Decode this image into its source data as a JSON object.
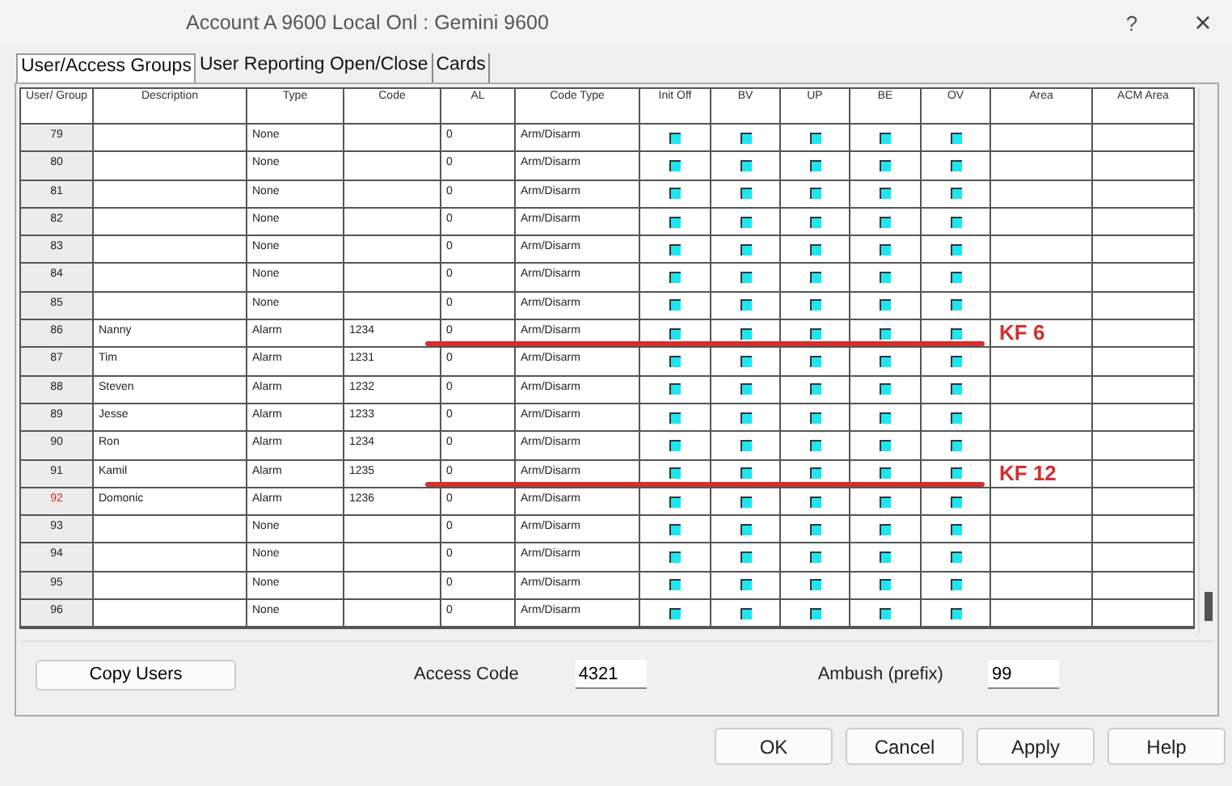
{
  "window": {
    "title": "Account A 9600 Local Onl : Gemini 9600",
    "help": "?",
    "close": "×"
  },
  "tabs": [
    {
      "label": "User/Access Groups",
      "selected": true
    },
    {
      "label": "User Reporting Open/Close",
      "selected": false
    },
    {
      "label": "Cards",
      "selected": false
    }
  ],
  "table": {
    "columns": [
      "User/ Group",
      "Description",
      "Type",
      "Code",
      "AL",
      "Code Type",
      "Init Off",
      "BV",
      "UP",
      "BE",
      "OV",
      "Area",
      "ACM Area"
    ],
    "rows": [
      {
        "user": "79",
        "description": "",
        "type": "None",
        "code": "",
        "al": "0",
        "code_type": "Arm/Disarm",
        "flags": [
          true,
          true,
          true,
          true,
          true
        ],
        "highlighted": false
      },
      {
        "user": "80",
        "description": "",
        "type": "None",
        "code": "",
        "al": "0",
        "code_type": "Arm/Disarm",
        "flags": [
          true,
          true,
          true,
          true,
          true
        ],
        "highlighted": false
      },
      {
        "user": "81",
        "description": "",
        "type": "None",
        "code": "",
        "al": "0",
        "code_type": "Arm/Disarm",
        "flags": [
          true,
          true,
          true,
          true,
          true
        ],
        "highlighted": false
      },
      {
        "user": "82",
        "description": "",
        "type": "None",
        "code": "",
        "al": "0",
        "code_type": "Arm/Disarm",
        "flags": [
          true,
          true,
          true,
          true,
          true
        ],
        "highlighted": false
      },
      {
        "user": "83",
        "description": "",
        "type": "None",
        "code": "",
        "al": "0",
        "code_type": "Arm/Disarm",
        "flags": [
          true,
          true,
          true,
          true,
          true
        ],
        "highlighted": false
      },
      {
        "user": "84",
        "description": "",
        "type": "None",
        "code": "",
        "al": "0",
        "code_type": "Arm/Disarm",
        "flags": [
          true,
          true,
          true,
          true,
          true
        ],
        "highlighted": false
      },
      {
        "user": "85",
        "description": "",
        "type": "None",
        "code": "",
        "al": "0",
        "code_type": "Arm/Disarm",
        "flags": [
          true,
          true,
          true,
          true,
          true
        ],
        "highlighted": false
      },
      {
        "user": "86",
        "description": "Nanny",
        "type": "Alarm",
        "code": "1234",
        "al": "0",
        "code_type": "Arm/Disarm",
        "flags": [
          true,
          true,
          true,
          true,
          true
        ],
        "highlighted": false,
        "annotation": "KF 6"
      },
      {
        "user": "87",
        "description": "Tim",
        "type": "Alarm",
        "code": "1231",
        "al": "0",
        "code_type": "Arm/Disarm",
        "flags": [
          true,
          true,
          true,
          true,
          true
        ],
        "highlighted": false
      },
      {
        "user": "88",
        "description": "Steven",
        "type": "Alarm",
        "code": "1232",
        "al": "0",
        "code_type": "Arm/Disarm",
        "flags": [
          true,
          true,
          true,
          true,
          true
        ],
        "highlighted": false
      },
      {
        "user": "89",
        "description": "Jesse",
        "type": "Alarm",
        "code": "1233",
        "al": "0",
        "code_type": "Arm/Disarm",
        "flags": [
          true,
          true,
          true,
          true,
          true
        ],
        "highlighted": false
      },
      {
        "user": "90",
        "description": "Ron",
        "type": "Alarm",
        "code": "1234",
        "al": "0",
        "code_type": "Arm/Disarm",
        "flags": [
          true,
          true,
          true,
          true,
          true
        ],
        "highlighted": false
      },
      {
        "user": "91",
        "description": "Kamil",
        "type": "Alarm",
        "code": "1235",
        "al": "0",
        "code_type": "Arm/Disarm",
        "flags": [
          true,
          true,
          true,
          true,
          true
        ],
        "highlighted": false,
        "annotation": "KF 12"
      },
      {
        "user": "92",
        "description": "Domonic",
        "type": "Alarm",
        "code": "1236",
        "al": "0",
        "code_type": "Arm/Disarm",
        "flags": [
          true,
          true,
          true,
          true,
          true
        ],
        "highlighted": true
      },
      {
        "user": "93",
        "description": "",
        "type": "None",
        "code": "",
        "al": "0",
        "code_type": "Arm/Disarm",
        "flags": [
          true,
          true,
          true,
          true,
          true
        ],
        "highlighted": false
      },
      {
        "user": "94",
        "description": "",
        "type": "None",
        "code": "",
        "al": "0",
        "code_type": "Arm/Disarm",
        "flags": [
          true,
          true,
          true,
          true,
          true
        ],
        "highlighted": false
      },
      {
        "user": "95",
        "description": "",
        "type": "None",
        "code": "",
        "al": "0",
        "code_type": "Arm/Disarm",
        "flags": [
          true,
          true,
          true,
          true,
          true
        ],
        "highlighted": false
      },
      {
        "user": "96",
        "description": "",
        "type": "None",
        "code": "",
        "al": "0",
        "code_type": "Arm/Disarm",
        "flags": [
          true,
          true,
          true,
          true,
          true
        ],
        "highlighted": false
      }
    ]
  },
  "copy_users_button": "Copy Users",
  "access_code": {
    "label": "Access Code",
    "value": "4321"
  },
  "ambush": {
    "label": "Ambush (prefix)",
    "value": "99"
  },
  "buttons": [
    "OK",
    "Cancel",
    "Apply",
    "Help"
  ]
}
